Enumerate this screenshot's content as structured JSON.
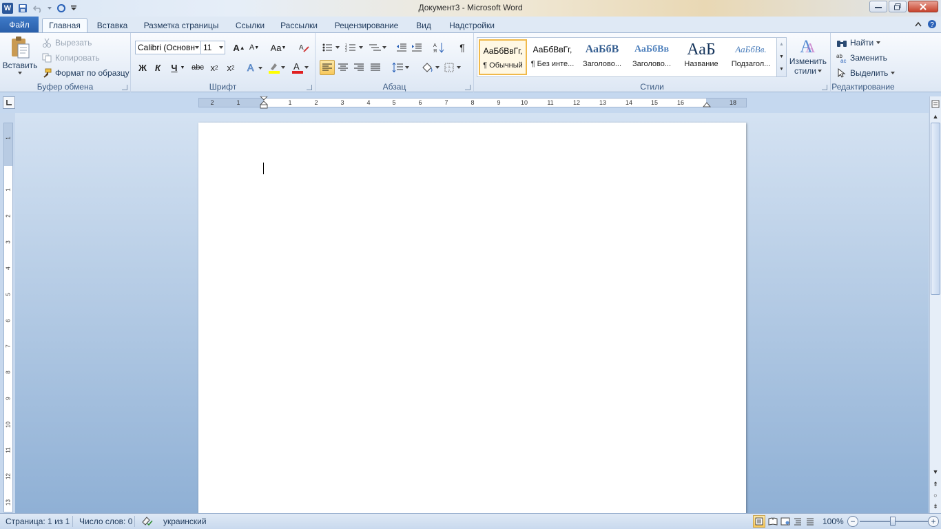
{
  "window": {
    "title": "Документ3  -  Microsoft Word",
    "app_logo": "W"
  },
  "tabs": [
    {
      "label": "Файл"
    },
    {
      "label": "Главная"
    },
    {
      "label": "Вставка"
    },
    {
      "label": "Разметка страницы"
    },
    {
      "label": "Ссылки"
    },
    {
      "label": "Рассылки"
    },
    {
      "label": "Рецензирование"
    },
    {
      "label": "Вид"
    },
    {
      "label": "Надстройки"
    }
  ],
  "clipboard": {
    "label": "Буфер обмена",
    "paste": "Вставить",
    "cut": "Вырезать",
    "copy": "Копировать",
    "format_painter": "Формат по образцу"
  },
  "font": {
    "label": "Шрифт",
    "name": "Calibri (Основн",
    "size": "11",
    "bold": "Ж",
    "italic": "К",
    "underline": "Ч",
    "strike": "abc",
    "case": "Aa"
  },
  "paragraph": {
    "label": "Абзац"
  },
  "styles": {
    "label": "Стили",
    "items": [
      {
        "sample": "АаБбВвГг,",
        "name": "¶ Обычный"
      },
      {
        "sample": "АаБбВвГг,",
        "name": "¶ Без инте..."
      },
      {
        "sample": "АаБбВ",
        "name": "Заголово..."
      },
      {
        "sample": "АаБбВв",
        "name": "Заголово..."
      },
      {
        "sample": "АаБ",
        "name": "Название"
      },
      {
        "sample": "АаБбВв.",
        "name": "Подзагол..."
      }
    ],
    "change_line1": "Изменить",
    "change_line2": "стили"
  },
  "editing": {
    "label": "Редактирование",
    "find": "Найти",
    "replace": "Заменить",
    "select": "Выделить"
  },
  "ruler": {
    "h_numbers": [
      "2",
      "1",
      "1",
      "2",
      "3",
      "4",
      "5",
      "6",
      "7",
      "8",
      "9",
      "10",
      "11",
      "12",
      "13",
      "14",
      "15",
      "16",
      "18"
    ],
    "v_numbers": [
      "1",
      "1",
      "2",
      "3",
      "4",
      "5",
      "6",
      "7",
      "8",
      "9",
      "10",
      "11",
      "12",
      "13"
    ]
  },
  "status": {
    "page": "Страница: 1 из 1",
    "words": "Число слов: 0",
    "language": "украинский",
    "zoom": "100%"
  }
}
